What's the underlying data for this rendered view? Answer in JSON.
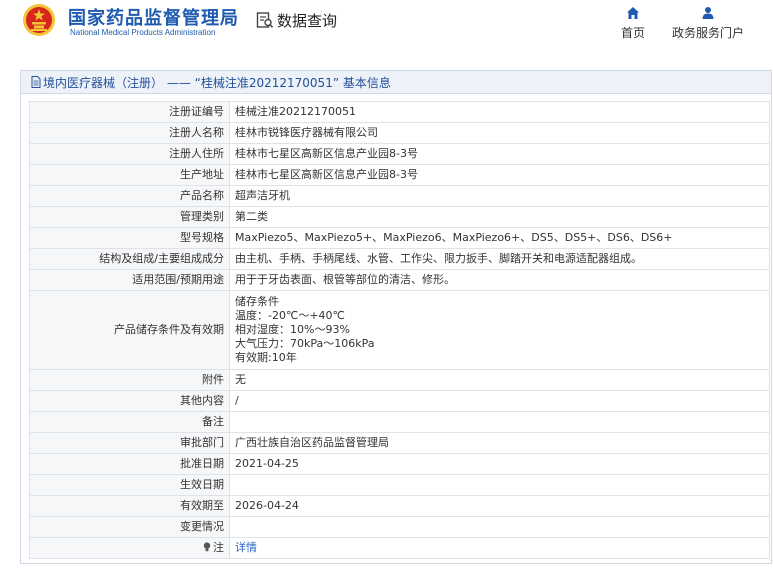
{
  "header": {
    "brand_cn": "国家药品监督管理局",
    "brand_en": "National Medical Products Administration",
    "data_query": "数据查询",
    "nav": {
      "home": "首页",
      "portal": "政务服务门户"
    }
  },
  "colors": {
    "brand_blue": "#1f5bb0",
    "emblem_red": "#d6261d",
    "emblem_gold": "#f3c433",
    "link": "#2a66c0"
  },
  "panel": {
    "title": "境内医疗器械（注册） ——  “桂械注准20212170051” 基本信息"
  },
  "rows": [
    {
      "key": "注册证编号",
      "value": "桂械注准20212170051"
    },
    {
      "key": "注册人名称",
      "value": "桂林市锐锋医疗器械有限公司"
    },
    {
      "key": "注册人住所",
      "value": "桂林市七星区高新区信息产业园8-3号"
    },
    {
      "key": "生产地址",
      "value": "桂林市七星区高新区信息产业园8-3号"
    },
    {
      "key": "产品名称",
      "value": "超声洁牙机"
    },
    {
      "key": "管理类别",
      "value": "第二类"
    },
    {
      "key": "型号规格",
      "value": "MaxPiezo5、MaxPiezo5+、MaxPiezo6、MaxPiezo6+、DS5、DS5+、DS6、DS6+"
    },
    {
      "key": "结构及组成/主要组成成分",
      "value": "由主机、手柄、手柄尾线、水管、工作尖、限力扳手、脚踏开关和电源适配器组成。"
    },
    {
      "key": "适用范围/预期用途",
      "value": "用于于牙齿表面、根管等部位的清洁、修形。"
    },
    {
      "key": "产品储存条件及有效期",
      "lines": [
        "储存条件",
        "温度：-20℃～+40℃",
        "相对湿度：10%～93%",
        "大气压力：70kPa～106kPa",
        "有效期:10年"
      ]
    },
    {
      "key": "附件",
      "value": "无"
    },
    {
      "key": "其他内容",
      "value": "/"
    },
    {
      "key": "备注",
      "value": ""
    },
    {
      "key": "审批部门",
      "value": "广西壮族自治区药品监督管理局"
    },
    {
      "key": "批准日期",
      "value": "2021-04-25"
    },
    {
      "key": "生效日期",
      "value": ""
    },
    {
      "key": "有效期至",
      "value": "2026-04-24"
    },
    {
      "key": "变更情况",
      "value": ""
    }
  ],
  "note": {
    "key": "注",
    "link": "详情"
  }
}
